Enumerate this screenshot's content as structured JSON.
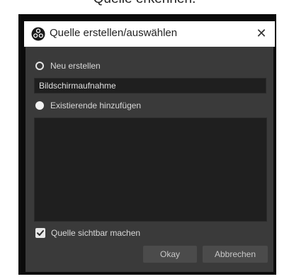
{
  "background_text": "Quelle erkennen.",
  "dialog": {
    "title": "Quelle erstellen/auswählen",
    "close_label": "✕",
    "option_new_label": "Neu erstellen",
    "name_value": "Bildschirmaufnahme",
    "option_existing_label": "Existierende hinzufügen",
    "visible_checkbox_label": "Quelle sichtbar machen",
    "visible_checked": true,
    "ok_label": "Okay",
    "cancel_label": "Abbrechen"
  },
  "icons": {
    "app": "obs-logo-icon",
    "close": "close-icon",
    "check": "checkmark-icon"
  },
  "colors": {
    "dialog_bg": "#3a3a3a",
    "field_bg": "#1f1f1f",
    "button_bg": "#4b4b4b",
    "titlebar_bg": "#ffffff"
  }
}
